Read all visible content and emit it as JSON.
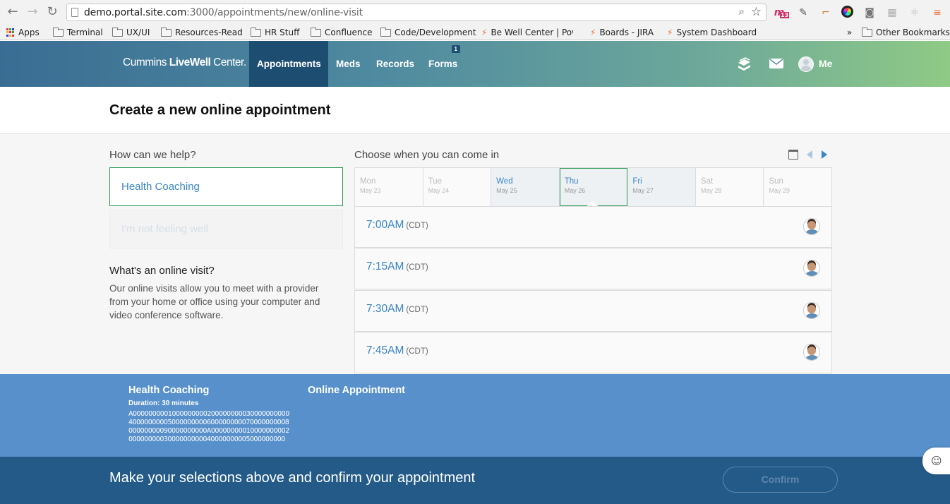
{
  "browser": {
    "url_host": "demo.portal.site.com",
    "url_path": ":3000/appointments/new/online-visit",
    "bookmarks": [
      "Apps",
      "Terminal",
      "UX/UI",
      "Resources-Read",
      "HR Stuff",
      "Confluence",
      "Code/Development",
      "Be Well Center | Pow",
      "Boards - JIRA",
      "System Dashboard -",
      "Other Bookmarks"
    ],
    "overflow": "»",
    "ext_badge": "13"
  },
  "header": {
    "logo_light": "Cummins ",
    "logo_bold": "LiveWell",
    "logo_tail": " Center.",
    "nav": [
      "Appointments",
      "Meds",
      "Records",
      "Forms"
    ],
    "forms_badge": "1",
    "me_label": "Me"
  },
  "page": {
    "title": "Create a new online appointment"
  },
  "help": {
    "label": "How can we help?",
    "options": [
      "Health Coaching",
      "I'm not feeling well"
    ],
    "info_title": "What's an online visit?",
    "info_body": "Our online visits allow you to meet with a provider from your home or office using your computer and video conference software."
  },
  "schedule": {
    "label": "Choose when you can come in",
    "days": [
      {
        "name": "Mon",
        "date": "May 23"
      },
      {
        "name": "Tue",
        "date": "May 24"
      },
      {
        "name": "Wed",
        "date": "May 25"
      },
      {
        "name": "Thu",
        "date": "May 26"
      },
      {
        "name": "Fri",
        "date": "May 27"
      },
      {
        "name": "Sat",
        "date": "May 28"
      },
      {
        "name": "Sun",
        "date": "May 29"
      }
    ],
    "slots": [
      {
        "time": "7:00AM",
        "tz": "(CDT)"
      },
      {
        "time": "7:15AM",
        "tz": "(CDT)"
      },
      {
        "time": "7:30AM",
        "tz": "(CDT)"
      },
      {
        "time": "7:45AM",
        "tz": "(CDT)"
      }
    ]
  },
  "summary": {
    "title": "Health Coaching",
    "duration": "Duration: 30 minutes",
    "code": "A00000000010000000002000000000300000000004000000000500000000060000000007000000000800000000090000000000A000000000100000000020000000003000000000040000000005000000000",
    "type": "Online Appointment"
  },
  "footer": {
    "message": "Make your selections above and confirm your appointment",
    "confirm": "Confirm"
  },
  "colors": {
    "accent_blue": "#3a85c6",
    "selected_green": "#2a9a55",
    "summary_bg": "#5890cc",
    "footer_bg": "#245a87"
  }
}
